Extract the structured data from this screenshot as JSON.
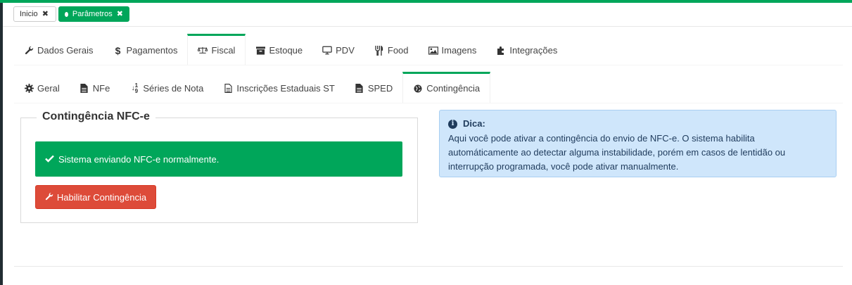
{
  "page_tabs": [
    {
      "label": "Inicio",
      "close": "✖"
    },
    {
      "label": "Parâmetros",
      "close": "✖"
    }
  ],
  "main_tabs": [
    {
      "label": "Dados Gerais",
      "icon": "wrench-icon"
    },
    {
      "label": "Pagamentos",
      "icon": "dollar-icon"
    },
    {
      "label": "Fiscal",
      "icon": "balance-scale-icon",
      "active": true
    },
    {
      "label": "Estoque",
      "icon": "archive-icon"
    },
    {
      "label": "PDV",
      "icon": "monitor-icon"
    },
    {
      "label": "Food",
      "icon": "cutlery-icon"
    },
    {
      "label": "Imagens",
      "icon": "image-icon"
    },
    {
      "label": "Integrações",
      "icon": "puzzle-icon"
    }
  ],
  "sub_tabs": [
    {
      "label": "Geral",
      "icon": "gear-icon"
    },
    {
      "label": "NFe",
      "icon": "file-icon"
    },
    {
      "label": "Séries de Nota",
      "icon": "sort-numeric-icon"
    },
    {
      "label": "Inscrições Estaduais ST",
      "icon": "file-text-icon"
    },
    {
      "label": "SPED",
      "icon": "file-icon"
    },
    {
      "label": "Contingência",
      "icon": "globe-icon",
      "active": true
    }
  ],
  "contingencia": {
    "legend": "Contingência NFC-e",
    "status": "Sistema enviando NFC-e normalmente.",
    "button": "Habilitar Contingência"
  },
  "dica": {
    "title": "Dica:",
    "text": "Aqui você pode ativar a contingência do envio de NFC-e. O sistema habilita automáticamente ao detectar alguma instabilidade, porém em casos de lentidão ou interrupção programada, você pode ativar manualmente."
  },
  "colors": {
    "accent": "#00a65a",
    "danger": "#dd4b39",
    "info_bg": "#cfe6fb"
  }
}
